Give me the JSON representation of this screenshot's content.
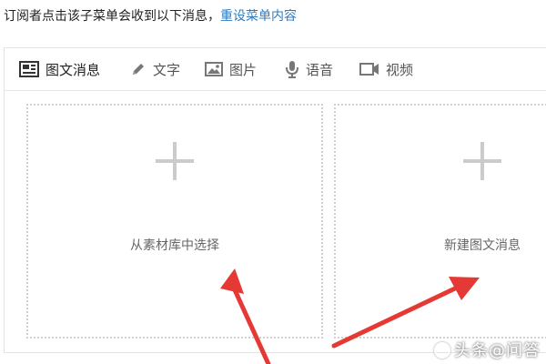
{
  "notice": {
    "text": "订阅者点击该子菜单会收到以下消息，",
    "link": "重设菜单内容"
  },
  "tabs": [
    {
      "label": "图文消息",
      "icon": "news-icon",
      "active": true
    },
    {
      "label": "文字",
      "icon": "pencil-icon",
      "active": false
    },
    {
      "label": "图片",
      "icon": "image-icon",
      "active": false
    },
    {
      "label": "语音",
      "icon": "microphone-icon",
      "active": false
    },
    {
      "label": "视频",
      "icon": "video-icon",
      "active": false
    }
  ],
  "areas": [
    {
      "label": "从素材库中选择",
      "icon": "plus-icon"
    },
    {
      "label": "新建图文消息",
      "icon": "plus-icon"
    }
  ],
  "annotations": {
    "arrow_color": "#e53935"
  },
  "watermark": "头条@问答",
  "colors": {
    "link": "#2f7bbf",
    "border": "#e3e3e3",
    "dotted": "#cfcfcf",
    "icon": "#6f6f6f"
  }
}
